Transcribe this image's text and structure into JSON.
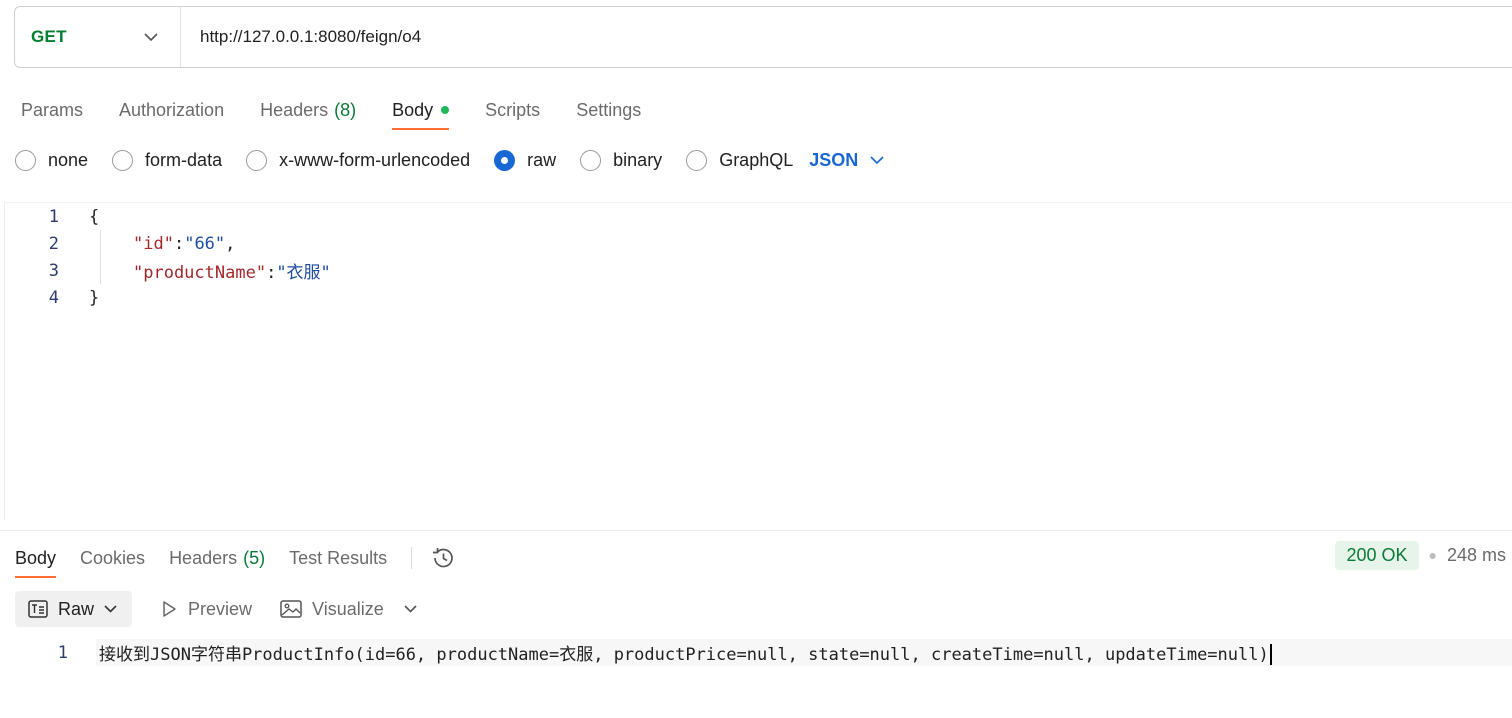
{
  "request": {
    "method": "GET",
    "url": "http://127.0.0.1:8080/feign/o4"
  },
  "request_tabs": [
    {
      "label": "Params"
    },
    {
      "label": "Authorization"
    },
    {
      "label": "Headers",
      "count": "(8)"
    },
    {
      "label": "Body",
      "active": true
    },
    {
      "label": "Scripts"
    },
    {
      "label": "Settings"
    }
  ],
  "body_types": {
    "options": [
      "none",
      "form-data",
      "x-www-form-urlencoded",
      "raw",
      "binary",
      "GraphQL"
    ],
    "selected": "raw",
    "language": "JSON"
  },
  "editor": {
    "lines": [
      {
        "num": "1",
        "text": "{"
      },
      {
        "num": "2",
        "key": "\"id\"",
        "sep": ":",
        "value": "\"66\"",
        "tail": ","
      },
      {
        "num": "3",
        "key": "\"productName\"",
        "sep": ":",
        "value": "\"衣服\"",
        "tail": ""
      },
      {
        "num": "4",
        "text": "}"
      }
    ]
  },
  "response_tabs": [
    {
      "label": "Body",
      "active": true
    },
    {
      "label": "Cookies"
    },
    {
      "label": "Headers",
      "count": "(5)"
    },
    {
      "label": "Test Results"
    }
  ],
  "status": {
    "code": "200 OK",
    "time": "248 ms",
    "color": "#0b7a37"
  },
  "response_toolbar": {
    "format": "Raw",
    "preview": "Preview",
    "visualize": "Visualize"
  },
  "response_body": {
    "line_num": "1",
    "text": "接收到JSON字符串ProductInfo(id=66, productName=衣服, productPrice=null, state=null, createTime=null, updateTime=null)"
  },
  "colors": {
    "accent": "#ff6c37",
    "radio_selected": "#1967d2",
    "method": "#007f31"
  }
}
